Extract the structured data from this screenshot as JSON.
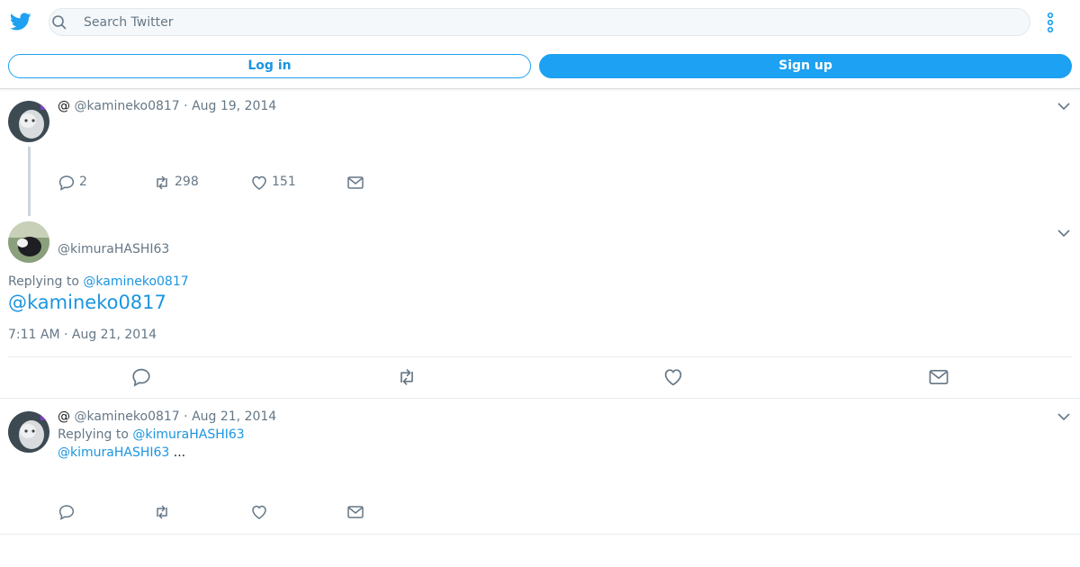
{
  "header": {
    "search_placeholder": "Search Twitter",
    "login_label": "Log in",
    "signup_label": "Sign up"
  },
  "colors": {
    "brand": "#1da1f2",
    "link": "#1b95e0",
    "secondary_text": "#657786"
  },
  "tweets": [
    {
      "display_prefix": "@",
      "handle": "@kamineko0817",
      "separator": " · ",
      "date": "Aug 19, 2014",
      "stats": {
        "replies": "2",
        "retweets": "298",
        "likes": "151"
      }
    },
    {
      "handle": "@kimuraHASHI63",
      "replying_prefix": "Replying to ",
      "replying_to": "@kamineko0817",
      "text": "@kamineko0817",
      "timestamp": "7:11 AM · Aug 21, 2014"
    },
    {
      "display_prefix": "@",
      "handle": "@kamineko0817",
      "separator": " · ",
      "date": "Aug 21, 2014",
      "replying_prefix": "Replying to ",
      "replying_to": "@kimuraHASHI63",
      "text_link": "@kimuraHASHI63",
      "text_rest": " ..."
    }
  ],
  "icons": [
    "twitter-logo-icon",
    "search-icon",
    "more-vertical-icon",
    "chevron-down-icon",
    "reply-icon",
    "retweet-icon",
    "like-icon",
    "message-icon"
  ]
}
